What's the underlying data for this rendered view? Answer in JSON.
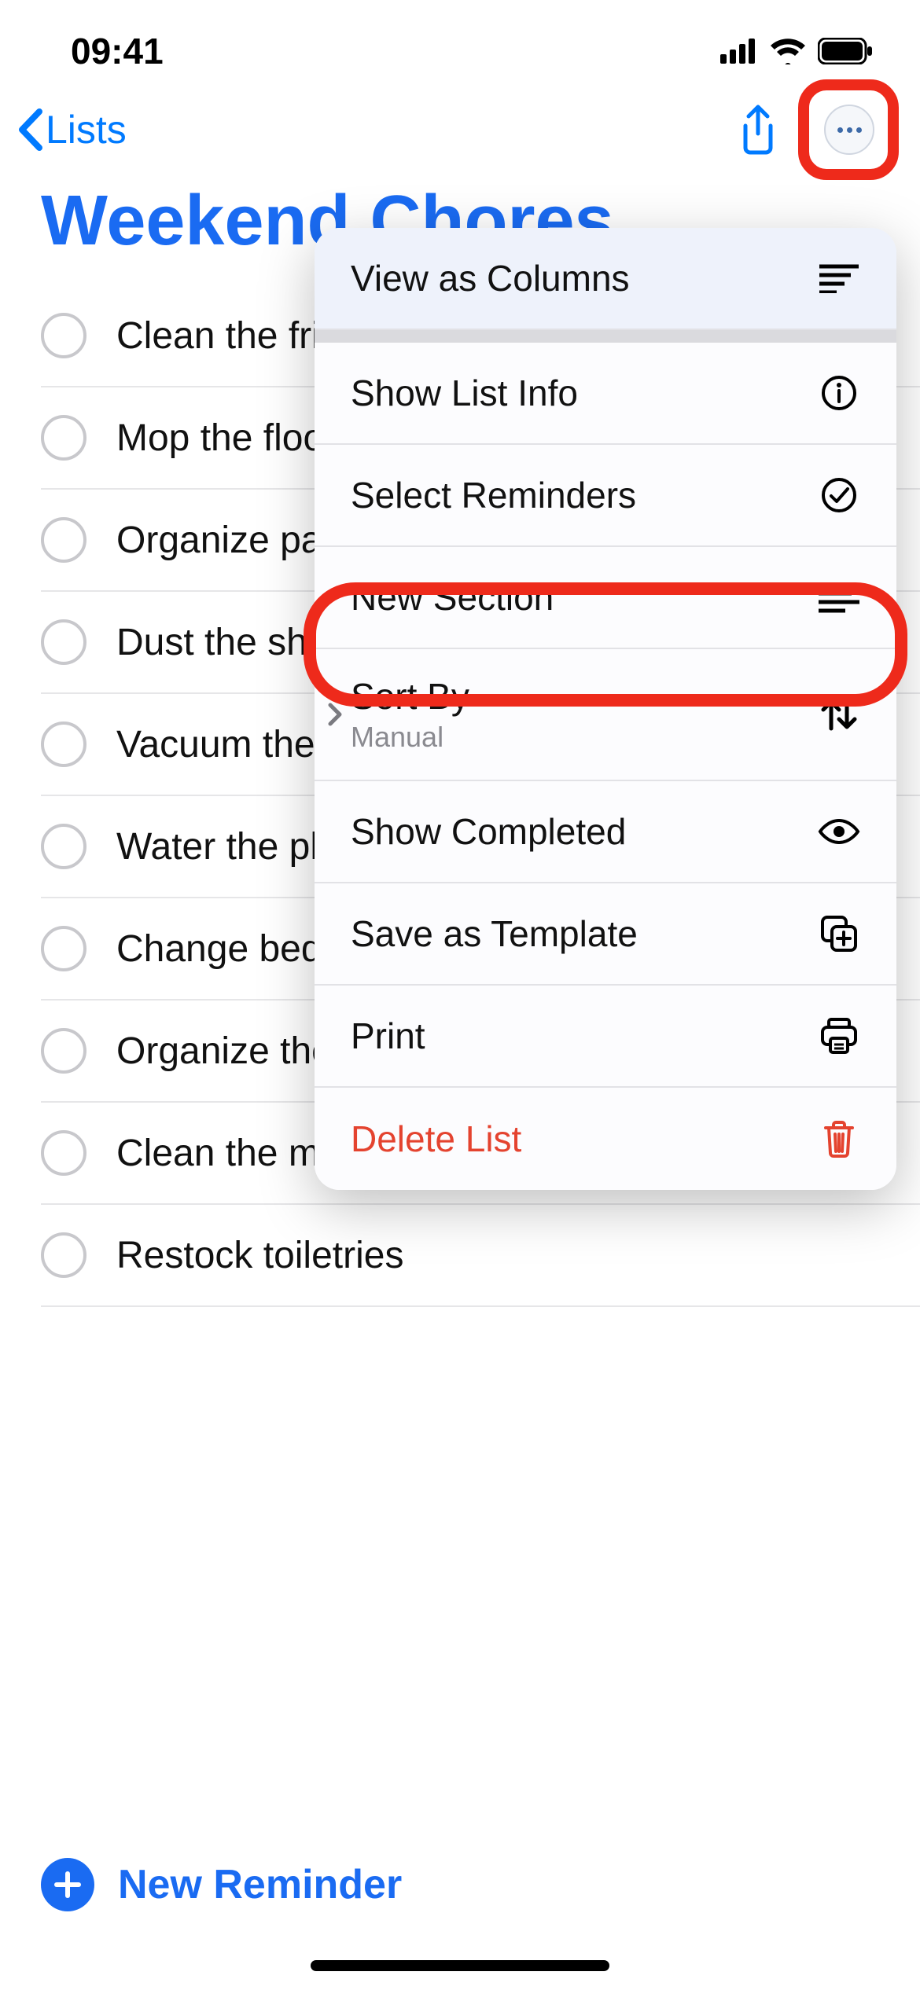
{
  "status": {
    "time": "09:41"
  },
  "nav": {
    "back_label": "Lists"
  },
  "title": "Weekend Chores",
  "reminders": [
    "Clean the fridge",
    "Mop the floors",
    "Organize pantry",
    "Dust the shelves",
    "Vacuum the rugs",
    "Water the plants",
    "Change bedsheets",
    "Organize the closet",
    "Clean the mirrors",
    "Restock toiletries"
  ],
  "menu": {
    "view_as_columns": "View as Columns",
    "show_list_info": "Show List Info",
    "select_reminders": "Select Reminders",
    "new_section": "New Section",
    "sort_by": "Sort By",
    "sort_by_value": "Manual",
    "show_completed": "Show Completed",
    "save_as_template": "Save as Template",
    "print": "Print",
    "delete_list": "Delete List"
  },
  "footer": {
    "new_reminder": "New Reminder"
  }
}
